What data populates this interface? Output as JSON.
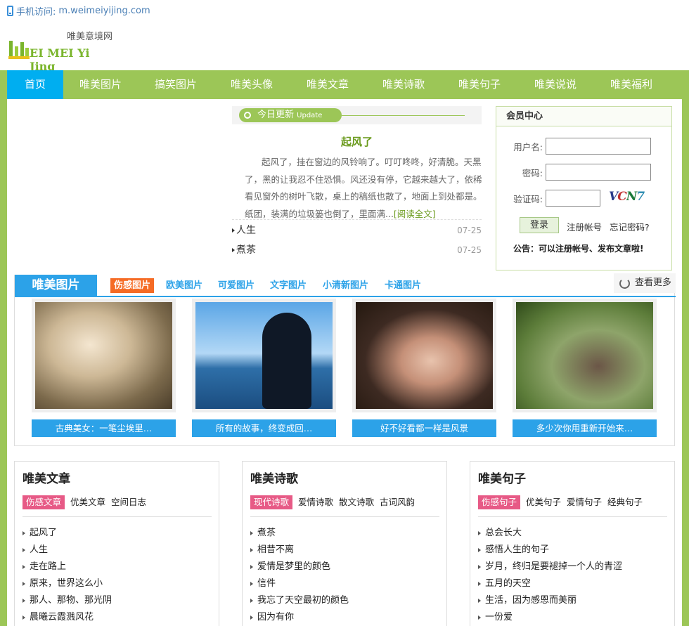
{
  "topbar": {
    "mobile_label": "手机访问:",
    "mobile_url": "m.weimeiyijing.com"
  },
  "logo": {
    "site_name": "唯美意境网",
    "letters_1": "EI ",
    "letters_2": "MEI ",
    "letters_3": "Yi ",
    "letters_4": "Jing"
  },
  "nav": {
    "items": [
      "首页",
      "唯美图片",
      "搞笑图片",
      "唯美头像",
      "唯美文章",
      "唯美诗歌",
      "唯美句子",
      "唯美说说",
      "唯美福利"
    ]
  },
  "today": {
    "label": "今日更新",
    "label_en": "Update today",
    "headline": "起风了",
    "summary": "起风了，挂在窗边的风铃响了。叮叮咚咚，好清脆。天黑了，黑的让我忍不住恐惧。风还没有停，它越来越大了，依稀看见窗外的树叶飞散，桌上的稿纸也散了，地面上到处都是。纸团，装满的垃圾篓也倒了，里面满...",
    "read_more": "[阅读全文]",
    "list": [
      {
        "title": "人生",
        "date": "07-25"
      },
      {
        "title": "煮茶",
        "date": "07-25"
      }
    ]
  },
  "member": {
    "title": "会员中心",
    "username_label": "用户名:",
    "password_label": "密码:",
    "captcha_label": "验证码:",
    "captcha_chars": [
      "V",
      "C",
      "N",
      "7"
    ],
    "login": "登录",
    "register": "注册帐号",
    "forgot": "忘记密码?",
    "notice": "公告：可以注册帐号、发布文章啦!"
  },
  "pictures": {
    "title": "唯美图片",
    "tabs": [
      "伤感图片",
      "欧美图片",
      "可爱图片",
      "文字图片",
      "小清新图片",
      "卡通图片"
    ],
    "see_more": "查看更多",
    "items": [
      {
        "caption": "古典美女：一笔尘埃里…"
      },
      {
        "caption": "所有的故事，终变成回…"
      },
      {
        "caption": "好不好看都一样是风景"
      },
      {
        "caption": "多少次你用重新开始来…"
      }
    ]
  },
  "articles": {
    "title": "唯美文章",
    "tabs": [
      "伤感文章",
      "优美文章",
      "空间日志"
    ],
    "items": [
      "起风了",
      "人生",
      "走在路上",
      "原来，世界这么小",
      "那人、那物、那光阴",
      "晨曦云霞溅风花"
    ]
  },
  "poems": {
    "title": "唯美诗歌",
    "tabs": [
      "现代诗歌",
      "爱情诗歌",
      "散文诗歌",
      "古词风韵"
    ],
    "items": [
      "煮茶",
      "相昔不离",
      "爱情是梦里的颜色",
      "信件",
      "我忘了天空最初的颜色",
      "因为有你"
    ]
  },
  "sentences": {
    "title": "唯美句子",
    "tabs": [
      "伤感句子",
      "优美句子",
      "爱情句子",
      "经典句子"
    ],
    "items": [
      "总会长大",
      "感悟人生的句子",
      "岁月，终归是要褪掉一个人的青涩",
      "五月的天空",
      "生活，因为感恩而美丽",
      "一份爱"
    ]
  }
}
